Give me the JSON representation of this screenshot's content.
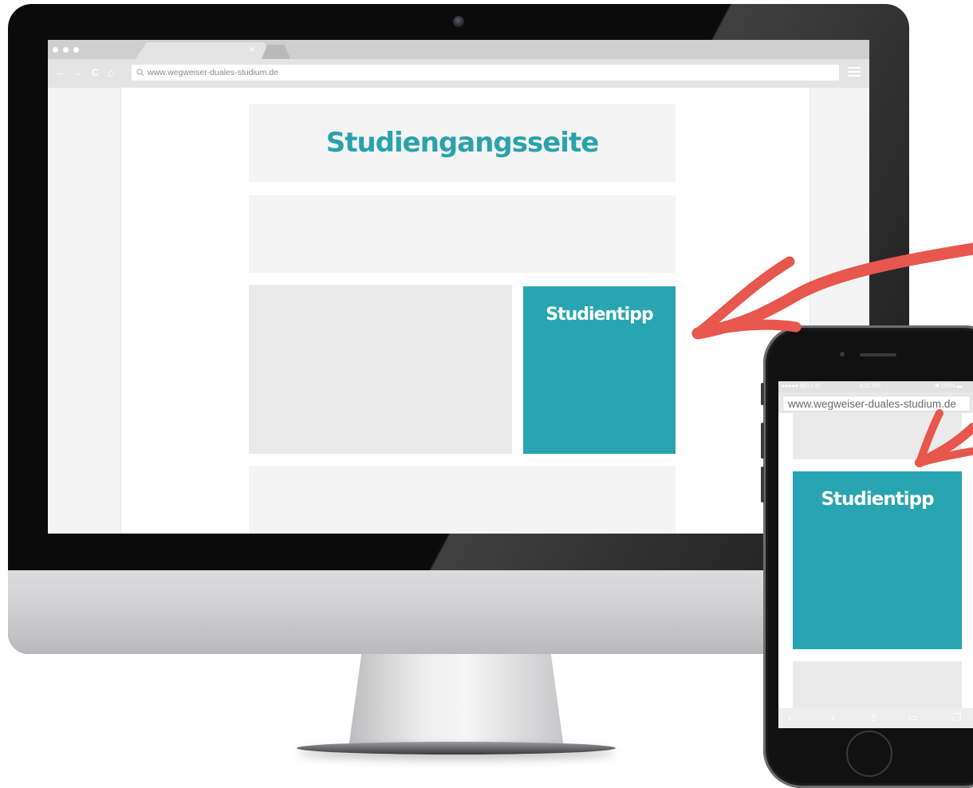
{
  "browser": {
    "url": "www.wegweiser-duales-studium.de",
    "tab_close_glyph": "×",
    "nav": {
      "back": "←",
      "forward": "→",
      "reload": "C",
      "home": "⌂"
    }
  },
  "desktop_page": {
    "title": "Studiengangsseite",
    "tip_label": "Studientipp"
  },
  "phone": {
    "carrier": "●●●●● BELL ✉",
    "time": "4:21 PM",
    "battery": "✱ 100% ▬",
    "url": "www.wegweiser-duales-studium.de",
    "tip_label": "Studientipp",
    "bottom_icons": [
      "chevron-left-icon",
      "chevron-right-icon",
      "share-icon",
      "bookmarks-icon",
      "tabs-icon"
    ]
  },
  "colors": {
    "accent_teal": "#28a5b0",
    "arrow_red": "#e8574d",
    "block_light": "#f4f4f4",
    "block_mid": "#eaeaea"
  }
}
